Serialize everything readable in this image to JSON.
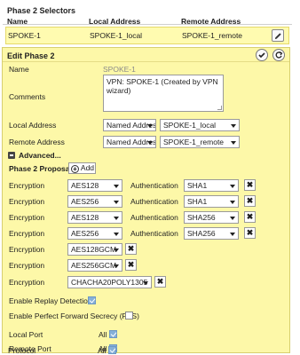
{
  "selectors": {
    "title": "Phase 2 Selectors",
    "columns": [
      "Name",
      "Local Address",
      "Remote Address"
    ],
    "row": {
      "name": "SPOKE-1",
      "local": "SPOKE-1_local",
      "remote": "SPOKE-1_remote"
    },
    "edit_icon": "pencil-icon"
  },
  "edit": {
    "title": "Edit Phase 2",
    "name_label": "Name",
    "name_value": "SPOKE-1",
    "comments_label": "Comments",
    "comments_value": "VPN: SPOKE-1 (Created by VPN wizard)",
    "local_label": "Local Address",
    "local_type": "Named Address",
    "local_value": "SPOKE-1_local",
    "remote_label": "Remote Address",
    "remote_type": "Named Address",
    "remote_value": "SPOKE-1_remote",
    "advanced_label": "Advanced...",
    "proposal_label": "Phase 2 Proposal",
    "add_label": "Add",
    "encryption_label": "Encryption",
    "auth_label": "Authentication",
    "proposals": [
      {
        "enc": "AES128",
        "auth": "SHA1"
      },
      {
        "enc": "AES256",
        "auth": "SHA1"
      },
      {
        "enc": "AES128",
        "auth": "SHA256"
      },
      {
        "enc": "AES256",
        "auth": "SHA256"
      }
    ],
    "gcm": [
      "AES128GCM",
      "AES256GCM",
      "CHACHA20POLY1305"
    ],
    "replay_label": "Enable Replay Detection",
    "replay_checked": true,
    "pfs_label": "Enable Perfect Forward Secrecy (PFS)",
    "pfs_checked": false,
    "ports": [
      {
        "label": "Local Port",
        "value": "All",
        "checked": true
      },
      {
        "label": "Remote Port",
        "value": "All",
        "checked": true
      },
      {
        "label": "Protocol",
        "value": "All",
        "checked": true
      }
    ]
  },
  "colors": {
    "highlight": "#fdf8a8",
    "checkbox": "#86b0d8"
  }
}
